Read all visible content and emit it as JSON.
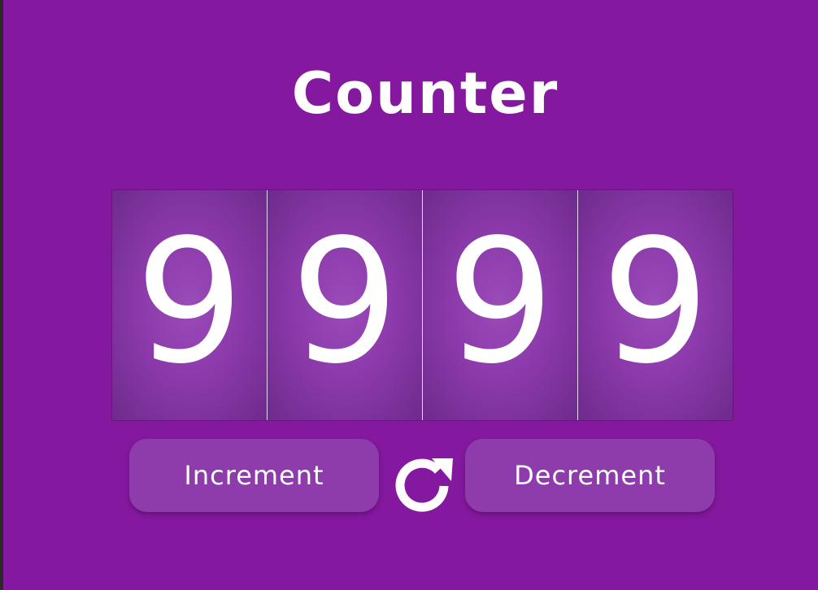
{
  "title": "Counter",
  "digits": [
    "9",
    "9",
    "9",
    "9"
  ],
  "buttons": {
    "increment_label": "Increment",
    "decrement_label": "Decrement"
  },
  "reset_icon": "refresh-icon",
  "colors": {
    "background": "#84189f",
    "button": "#8e3cab",
    "digit_tile": "#8c3aab",
    "text": "#ffffff"
  }
}
